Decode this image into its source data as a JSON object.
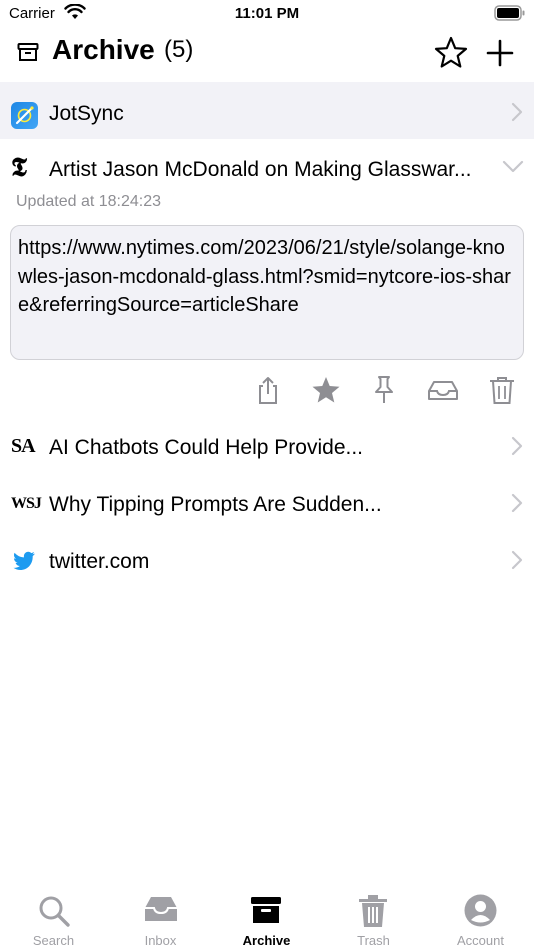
{
  "status_bar": {
    "carrier": "Carrier",
    "time": "11:01 PM"
  },
  "header": {
    "title": "Archive",
    "count": "(5)"
  },
  "items": [
    {
      "title": "JotSync"
    },
    {
      "title": "Artist Jason McDonald on Making Glasswar...",
      "source_logo": "𝕿",
      "updated": "Updated at 18:24:23",
      "url": "https://www.nytimes.com/2023/06/21/style/solange-knowles-jason-mcdonald-glass.html?smid=nytcore-ios-share&referringSource=articleShare"
    },
    {
      "title": "AI Chatbots Could Help Provide...",
      "source_logo": "SA"
    },
    {
      "title": "Why Tipping Prompts Are Sudden...",
      "source_logo": "WSJ"
    },
    {
      "title": "twitter.com"
    }
  ],
  "tabs": [
    {
      "label": "Search"
    },
    {
      "label": "Inbox"
    },
    {
      "label": "Archive"
    },
    {
      "label": "Trash"
    },
    {
      "label": "Account"
    }
  ],
  "colors": {
    "accent": "#000000",
    "inactive": "#a0a0a5",
    "twitter": "#1d9bf0",
    "selected_row": "#f2f2f7"
  }
}
